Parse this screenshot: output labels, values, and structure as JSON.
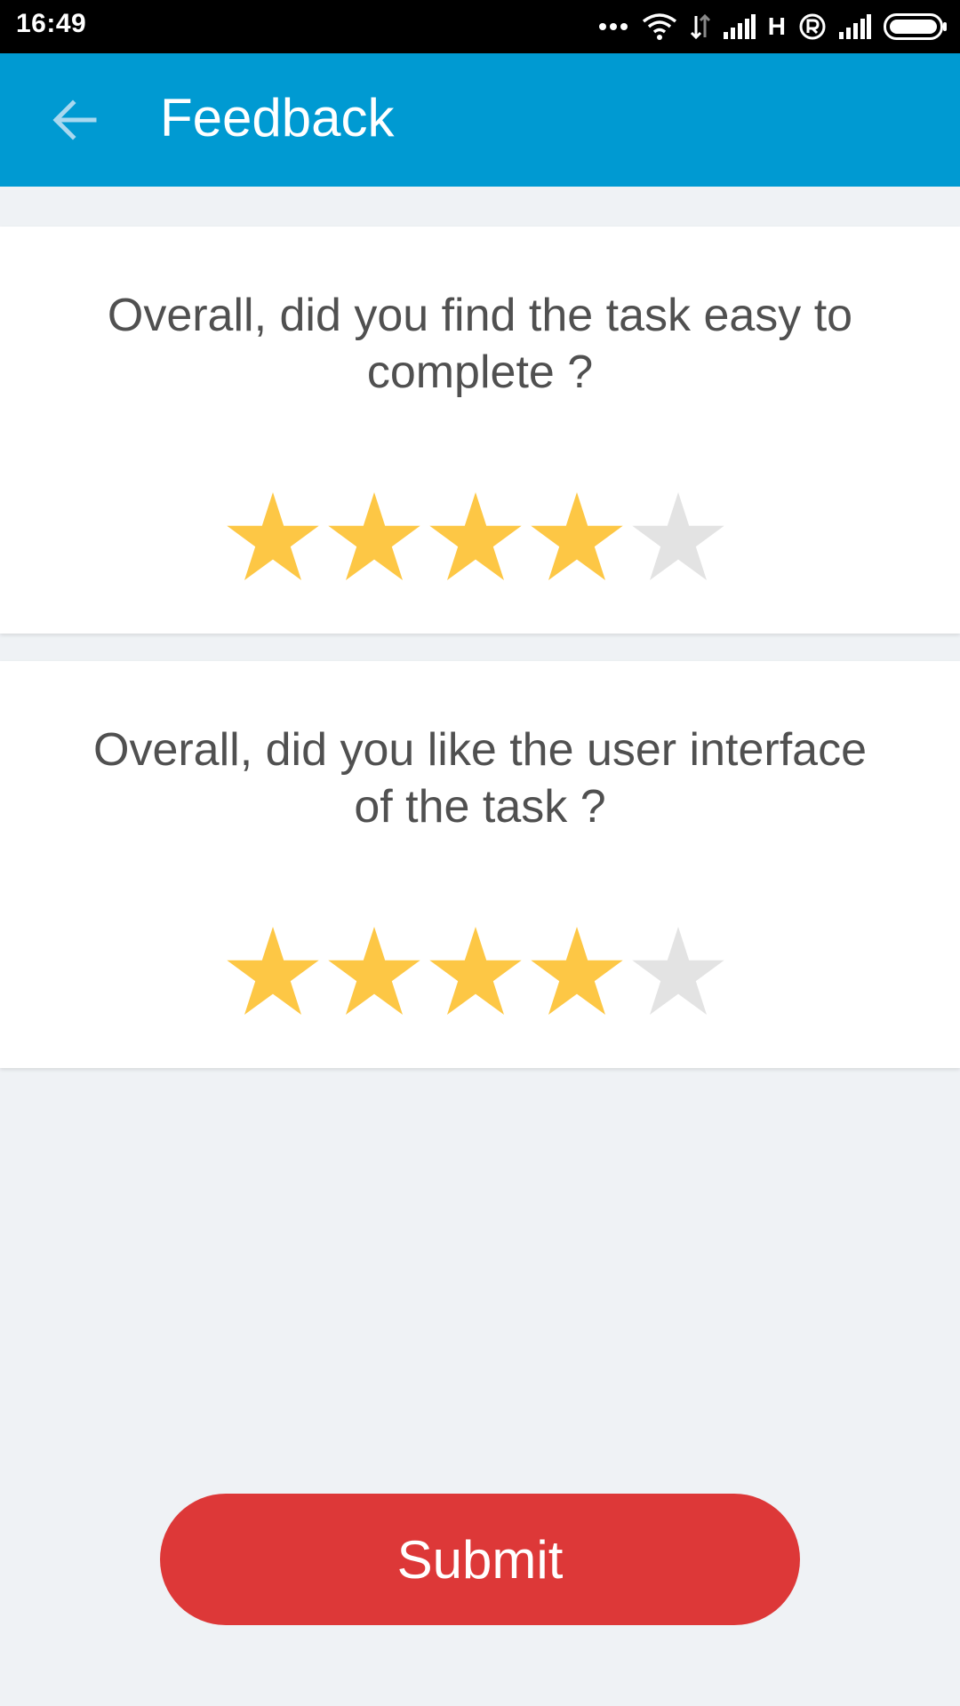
{
  "status_bar": {
    "time": "16:49",
    "network_label": "H",
    "icons": [
      "more-dots-icon",
      "wifi-icon",
      "data-transfer-icon",
      "signal-icon",
      "registered-icon",
      "signal-icon",
      "battery-icon"
    ]
  },
  "header": {
    "title": "Feedback",
    "back_icon": "back-arrow-icon"
  },
  "questions": [
    {
      "text": "Overall, did you find the task easy to complete ?",
      "rating": 4,
      "max_rating": 5
    },
    {
      "text": "Overall, did you like the user interface of the task ?",
      "rating": 4,
      "max_rating": 5
    }
  ],
  "submit": {
    "label": "Submit"
  },
  "colors": {
    "app_bar": "#009ad2",
    "star_filled": "#fdc745",
    "star_empty": "#e3e3e3",
    "submit_button": "#dd3838",
    "background": "#eff2f5",
    "question_text": "#505050"
  }
}
